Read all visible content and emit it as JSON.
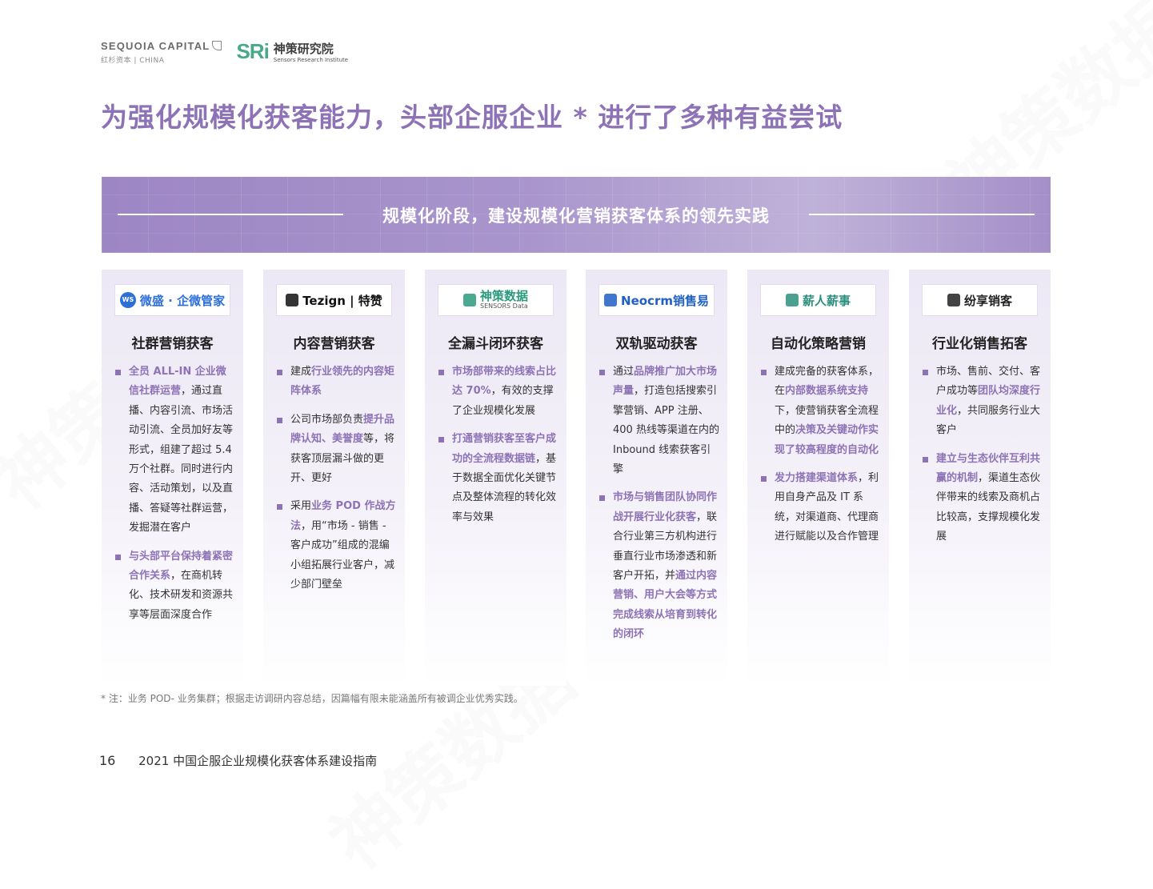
{
  "header": {
    "sequoia_name": "SEQUOIA CAPITAL",
    "sequoia_sub": "红杉资本 | CHINA",
    "sri_mark": "SRi",
    "sri_cn": "神策研究院",
    "sri_en": "Sensors Research Institute"
  },
  "title": "为强化规模化获客能力，头部企服企业 * 进行了多种有益尝试",
  "banner": "规模化阶段，建设规模化营销获客体系的领先实践",
  "cards": [
    {
      "logo": "微盛 · 企微管家",
      "logo_badge": "WS",
      "logo_color": "#2d6fd9",
      "title": "社群营销获客",
      "items": [
        [
          {
            "t": "全员 ALL-IN 企业微信社群运营",
            "h": true
          },
          {
            "t": "，通过直播、内容引流、市场活动引流、全员加好友等形式，组建了超过 5.4 万个社群。同时进行内容、活动策划，以及直播、答疑等社群运营，发掘潜在客户",
            "h": false
          }
        ],
        [
          {
            "t": "与头部平台保持着紧密合作关系",
            "h": true
          },
          {
            "t": "，在商机转化、技术研发和资源共享等层面深度合作",
            "h": false
          }
        ]
      ]
    },
    {
      "logo": "Tezign | 特赞",
      "logo_badge": "",
      "logo_color": "#111111",
      "title": "内容营销获客",
      "items": [
        [
          {
            "t": "建成",
            "h": false
          },
          {
            "t": "行业领先的内容矩阵体系",
            "h": true
          }
        ],
        [
          {
            "t": "公司市场部负责",
            "h": false
          },
          {
            "t": "提升品牌认知、美誉度",
            "h": true
          },
          {
            "t": "等，将获客顶层漏斗做的更开、更好",
            "h": false
          }
        ],
        [
          {
            "t": "采用",
            "h": false
          },
          {
            "t": "业务 POD 作战方法",
            "h": true
          },
          {
            "t": "，用“市场 - 销售 - 客户成功”组成的混编小组拓展行业客户，减少部门壁垒",
            "h": false
          }
        ]
      ]
    },
    {
      "logo": "神策数据",
      "logo_sub": "SENSORS Data",
      "logo_badge": "",
      "logo_color": "#2a9a7c",
      "title": "全漏斗闭环获客",
      "items": [
        [
          {
            "t": "市场部带来的线索占比达 70%",
            "h": true
          },
          {
            "t": "，有效的支撑了企业规模化发展",
            "h": false
          }
        ],
        [
          {
            "t": "打通营销获客至客户成功的全流程数据链",
            "h": true
          },
          {
            "t": "，基于数据全面优化关键节点及整体流程的转化效率与效果",
            "h": false
          }
        ]
      ]
    },
    {
      "logo": "Neocrm销售易",
      "logo_badge": "",
      "logo_color": "#1f5fc6",
      "title": "双轨驱动获客",
      "items": [
        [
          {
            "t": "通过",
            "h": false
          },
          {
            "t": "品牌推广加大市场声量",
            "h": true
          },
          {
            "t": "，打造包括搜索引擎营销、APP 注册、400 热线等渠道在内的 Inbound 线索获客引擎",
            "h": false
          }
        ],
        [
          {
            "t": "市场与销售团队协同作战开展行业化获客",
            "h": true
          },
          {
            "t": "，联合行业第三方机构进行垂直行业市场渗透和新客户开拓，并",
            "h": false
          },
          {
            "t": "通过内容营销、用户大会等方式完成线索从培育到转化的闭环",
            "h": true
          }
        ]
      ]
    },
    {
      "logo": "薪人薪事",
      "logo_badge": "",
      "logo_color": "#2b8f7d",
      "title": "自动化策略营销",
      "items": [
        [
          {
            "t": "建成完备的获客体系，在",
            "h": false
          },
          {
            "t": "内部数据系统支持",
            "h": true
          },
          {
            "t": "下，使营销获客全流程中的",
            "h": false
          },
          {
            "t": "决策及关键动作实现了较高程度的自动化",
            "h": true
          }
        ],
        [
          {
            "t": "发力搭建渠道体系",
            "h": true
          },
          {
            "t": "，利用自身产品及 IT 系统，对渠道商、代理商进行赋能以及合作管理",
            "h": false
          }
        ]
      ]
    },
    {
      "logo": "纷享销客",
      "logo_badge": "",
      "logo_color": "#222222",
      "title": "行业化销售拓客",
      "items": [
        [
          {
            "t": "市场、售前、交付、客户成功等",
            "h": false
          },
          {
            "t": "团队均深度行业化",
            "h": true
          },
          {
            "t": "，共同服务行业大客户",
            "h": false
          }
        ],
        [
          {
            "t": "建立与生态伙伴互利共赢的机制",
            "h": true
          },
          {
            "t": "，渠道生态伙伴带来的线索及商机占比较高，支撑规模化发展",
            "h": false
          }
        ]
      ]
    }
  ],
  "footnote": "* 注：业务 POD- 业务集群；根据走访调研内容总结，因篇幅有限未能涵盖所有被调企业优秀实践。",
  "footer": {
    "page": "16",
    "doc_title": "2021 中国企服企业规模化获客体系建设指南"
  },
  "colors": {
    "accent": "#8d73b5",
    "banner": "#a995cc"
  }
}
